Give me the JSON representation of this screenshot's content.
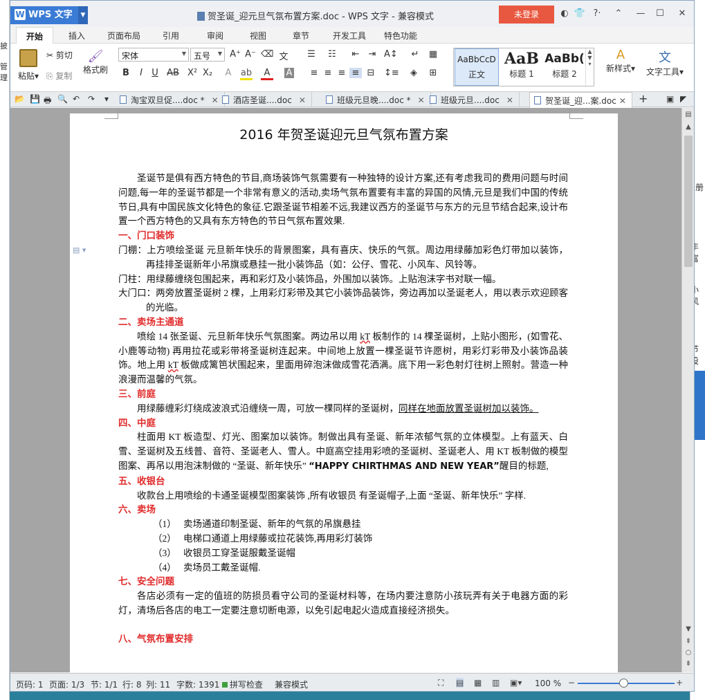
{
  "app": {
    "logo": "WPS 文字",
    "logo_mark": "W",
    "title": "贺圣诞_迎元旦气氛布置方案.doc - WPS 文字 - 兼容模式",
    "login_label": "未登录"
  },
  "menu": [
    "开始",
    "插入",
    "页面布局",
    "引用",
    "审阅",
    "视图",
    "章节",
    "开发工具",
    "特色功能"
  ],
  "ribbon": {
    "paste": "粘贴",
    "cut": "剪切",
    "copy": "复制",
    "format_painter": "格式刷",
    "font": "宋体",
    "size": "五号",
    "styles": [
      {
        "preview": "AaBbCcD",
        "name": "正文"
      },
      {
        "preview": "AaB",
        "name": "标题 1"
      },
      {
        "preview": "AaBb(",
        "name": "标题 2"
      }
    ],
    "new_style": "新样式",
    "text_tool": "文字工具"
  },
  "tabs": [
    {
      "label": "淘宝双旦促....doc *"
    },
    {
      "label": "酒店圣诞....doc"
    },
    {
      "label": "班级元旦晚....doc *"
    },
    {
      "label": "班级元旦....doc"
    },
    {
      "label": "贺圣诞_迎...案.doc"
    }
  ],
  "doc": {
    "title": "2016 年贺圣诞迎元旦气氛布置方案",
    "intro": "圣诞节是俱有西方特色的节目,商场装饰气氛需要有一种独特的设计方案,还有考虑我司的费用问题与时间问题,每一年的圣诞节都是一个非常有意义的活动,卖场气氛布置要有丰富的异国的风情,元旦是我们中国的传统节日,具有中国民族文化特色的象征.它跟圣诞节相差不远,我建议西方的圣诞节与东方的元旦节结合起来,设计布置一个西方特色的又具有东方特色的节日气氛布置效果.",
    "s1": "一、门口装饰",
    "s1_p1": "门棚：上方喷绘圣诞  元旦新年快乐的背景图案，具有喜庆、快乐的气氛。周边用绿藤加彩色灯带加以装饰，再挂排圣诞新年小吊旗或悬挂一批小装饰品（如：公仔、雪花、小风车、风铃等。",
    "s1_p2": "门柱：用绿藤缠绕包围起来，再和彩灯及小装饰品，外围加以装饰。上贴泡沫字书对联一幅。",
    "s1_p3": "大门口：两旁放置圣诞树 2 棵，上用彩灯彩带及其它小装饰品装饰，旁边再加以圣诞老人，用以表示欢迎顾客的光临。",
    "s2": "二、卖场主通道",
    "s2_a": "喷绘 14 张圣诞、元旦新年快乐气氛图案。两边吊以用 ",
    "s2_kt1": "kT",
    "s2_b": " 板制作的 14 棵圣诞树，上贴小图形，(如雪花、小鹿等动物) 再用拉花或彩带将圣诞树连起来。中间地上放置一棵圣诞节许愿树，用彩灯彩带及小装饰品装饰。地上用 ",
    "s2_kt2": "kT",
    "s2_c": " 板做成篱笆状围起来，里面用碎泡沫做成雪花洒满。底下用一彩色射灯往树上照射。营造一种浪漫而温馨的气氛。",
    "s3": "三、前庭",
    "s3_a": "用绿藤缠彩灯绕成波浪式沿缠绕一周，可放一棵同样的圣诞树，",
    "s3_b": "同样在地面放置圣诞树加以装饰。",
    "s4": "四、中庭",
    "s4_a": "柱面用 KT 板造型、灯光、图案加以装饰。制做出具有圣诞、新年浓郁气氛的立体模型。上有蓝天、白雪、圣诞树及五线普、音符、圣诞老人、雪人。中庭高空挂用彩喷的圣诞树、圣诞老人、用 KT 板制做的模型图案、再吊以用泡沫制做的 “圣诞、新年快乐”  ",
    "s4_eng": "“HAPPY CHIRTHMAS AND NEW   YEAR”",
    "s4_b": "醒目的标题,",
    "s5": "五、收银台",
    "s5_p": "收款台上用喷绘的卡通圣诞模型图案装饰 ,所有收银员    有圣诞帽子,上面 “圣诞、新年快乐” 字样.",
    "s6": "六、卖场",
    "s6_items": [
      {
        "n": "（1）",
        "t": "卖场通道印制圣诞、新年的气氛的吊旗悬挂"
      },
      {
        "n": "（2）",
        "t": "电梯口通道上用绿藤或拉花装饰,再用彩灯装饰"
      },
      {
        "n": "（3）",
        "t": "收银员工穿圣诞服戴圣诞帽"
      },
      {
        "n": "（4）",
        "t": "卖场员工戴圣诞帽."
      }
    ],
    "s7": "七、安全问题",
    "s7_p": "各店必须有一定的值班的防损员看守公司的圣诞材料等，在场内要注意防小孩玩弄有关于电器方面的彩灯，清场后各店的电工一定要注意切断电源，以免引起电起火造成直接经济损失。",
    "s8": "八、气氛布置安排"
  },
  "status": {
    "page_code": "页码: 1",
    "pages": "页面: 1/3",
    "section": "节: 1/1",
    "row": "行: 8",
    "col": "列: 11",
    "words": "字数: 1391",
    "spell": "拼写检查",
    "mode": "兼容模式",
    "zoom": "100 %"
  },
  "backdrop_right": [
    "册",
    "丰富",
    "小风",
    "节设"
  ],
  "backdrop_left": [
    "披",
    "管理"
  ]
}
